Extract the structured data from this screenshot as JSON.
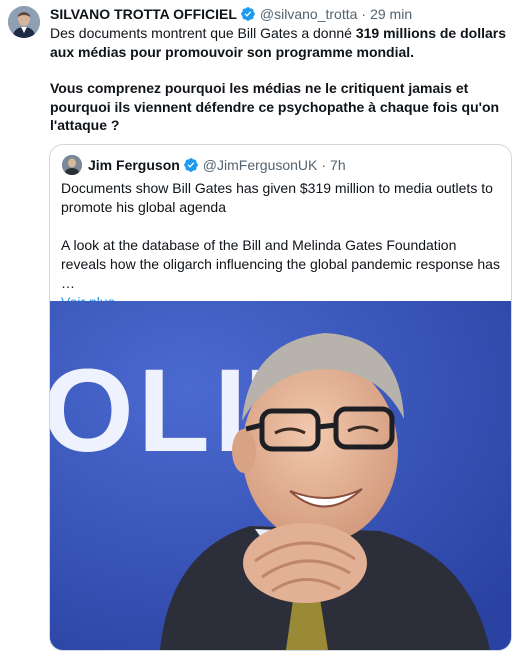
{
  "tweet": {
    "author_name": "SILVANO TROTTA OFFICIEL",
    "handle": "@silvano_trotta",
    "separator": "·",
    "time": "29 min",
    "text_part1": "Des documents montrent que Bill Gates a donné ",
    "text_bold": "319 millions de dollars aux médias pour promouvoir son programme mondial.",
    "text_part2": "Vous comprenez pourquoi les médias ne le critiquent jamais et pourquoi ils viennent défendre ce psychopathe à chaque fois qu'on l'attaque ?"
  },
  "quoted": {
    "author_name": "Jim Ferguson",
    "handle": "@JimFergusonUK",
    "separator": "·",
    "time": "7h",
    "text1": "Documents show Bill Gates has given $319 million to media outlets to promote his global agenda",
    "text2": "A look at the database of the Bill and Melinda Gates Foundation reveals how the oligarch influencing the global pandemic response has …",
    "show_more": "Voir plus",
    "backdrop_text": "OLITI"
  },
  "colors": {
    "verified": "#1d9bf0",
    "link": "#1d9bf0",
    "secondary_text": "#536471",
    "photo_background": "#3452bd"
  }
}
